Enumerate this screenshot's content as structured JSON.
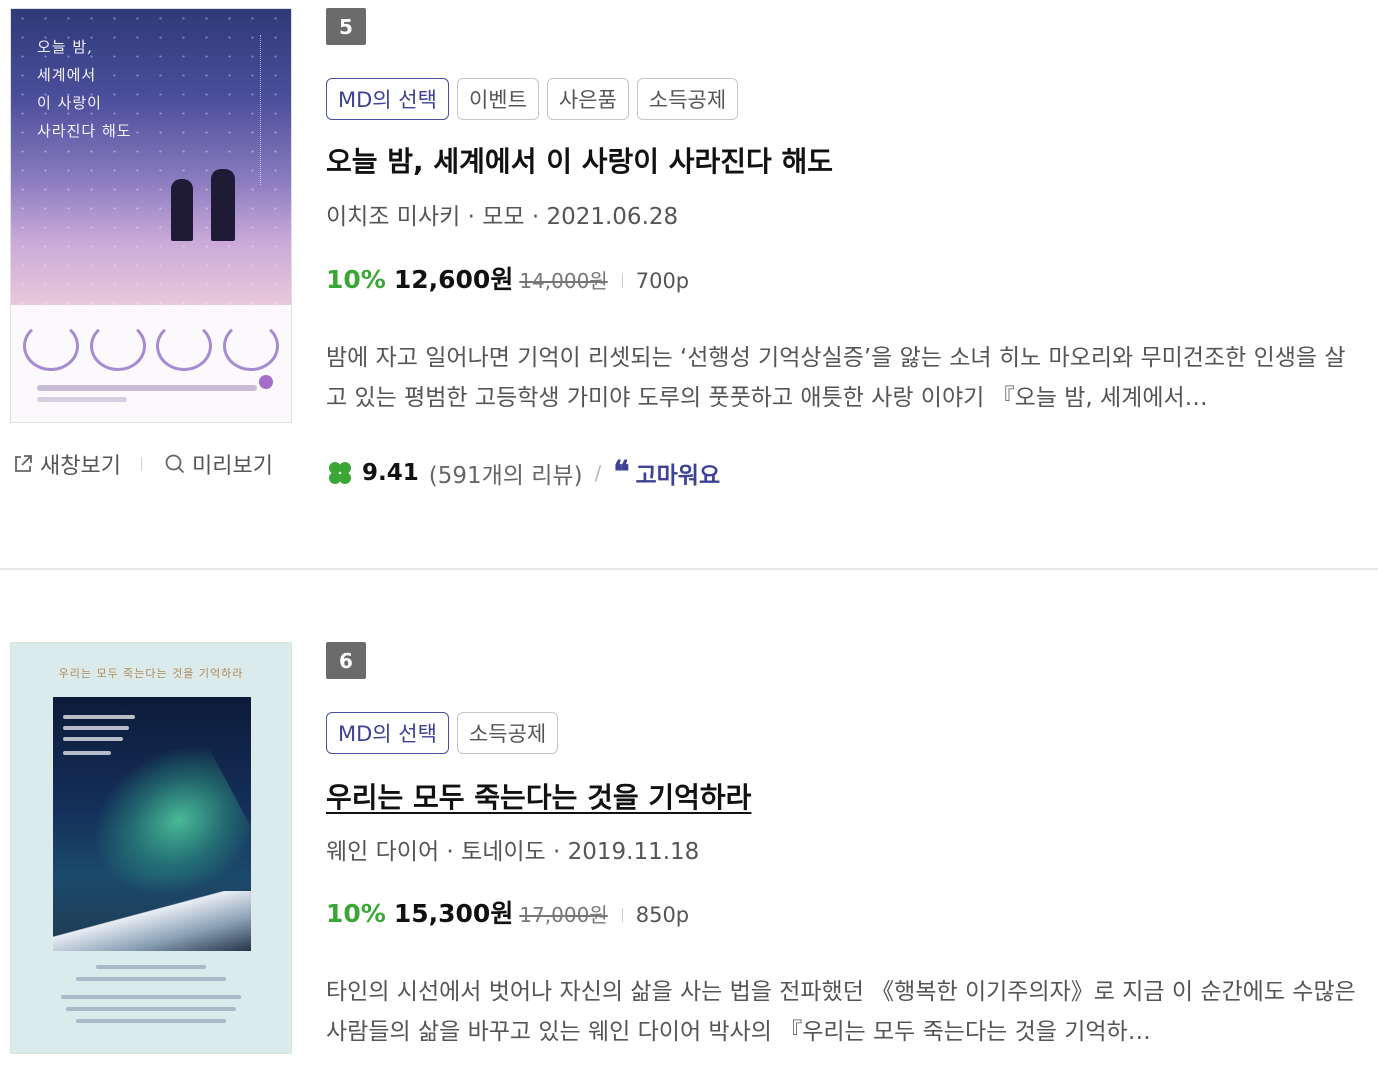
{
  "items": [
    {
      "rank": "5",
      "badges": [
        "MD의 선택",
        "이벤트",
        "사은품",
        "소득공제"
      ],
      "title": "오늘 밤, 세계에서 이 사랑이 사라진다 해도",
      "meta": "이치조 미사키 · 모모 · 2021.06.28",
      "discount": "10%",
      "sale_price": "12,600원",
      "original_price": "14,000원",
      "pages": "700p",
      "description": "밤에 자고 일어나면 기억이 리셋되는 ‘선행성 기억상실증’을 앓는 소녀 히노 마오리와 무미건조한 인생을 살고 있는 평범한 고등학생 가미야 도루의 풋풋하고 애틋한 사랑 이야기 『오늘 밤, 세계에서…",
      "rating": "9.41",
      "reviews": "(591개의 리뷰)",
      "thanks": "고마워요",
      "cover_text": [
        "오늘 밤,",
        "세계에서",
        "이 사랑이",
        "사라진다 해도"
      ]
    },
    {
      "rank": "6",
      "badges": [
        "MD의 선택",
        "소득공제"
      ],
      "title": "우리는 모두 죽는다는 것을 기억하라",
      "meta": "웨인 다이어 · 토네이도 · 2019.11.18",
      "discount": "10%",
      "sale_price": "15,300원",
      "original_price": "17,000원",
      "pages": "850p",
      "description": "타인의 시선에서 벗어나 자신의 삶을 사는 법을 전파했던 《행복한 이기주의자》로 지금 이 순간에도 수많은 사람들의 삶을 바꾸고 있는 웨인 다이어 박사의 『우리는 모두 죽는다는 것을 기억하…",
      "cover_top": "우리는 모두 죽는다는 것을 기억하라"
    }
  ],
  "actions": {
    "new_window": "새창보기",
    "preview": "미리보기"
  },
  "colors": {
    "discount": "#3aa635",
    "md_badge": "#3d4294",
    "rank_bg": "#6b6b6b"
  },
  "icons": {
    "new_window": "external-link-icon",
    "preview": "search-icon",
    "rating": "clover-icon",
    "thanks": "quote-icon"
  }
}
